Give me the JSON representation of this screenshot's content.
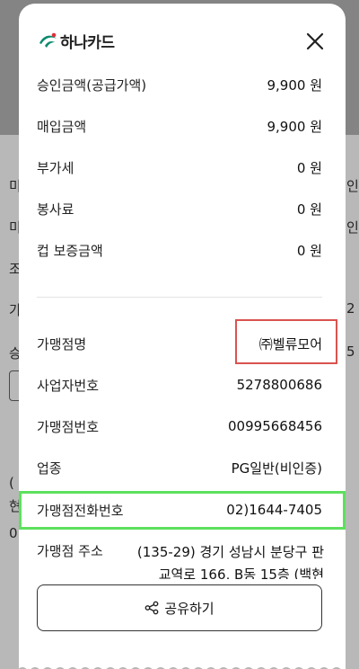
{
  "background": {
    "fragments_left": [
      "미",
      "미",
      "조",
      "가",
      "승",
      "(",
      "현",
      "0"
    ],
    "fragments_right": [
      "인",
      "인",
      "2",
      "5"
    ]
  },
  "receipt": {
    "brand": "하나카드",
    "rows_top": [
      {
        "label": "승인금액(공급가액)",
        "value": "9,900 원"
      },
      {
        "label": "매입금액",
        "value": "9,900 원"
      },
      {
        "label": "부가세",
        "value": "0 원"
      },
      {
        "label": "봉사료",
        "value": "0 원"
      },
      {
        "label": "컵 보증금액",
        "value": "0 원"
      }
    ],
    "rows_merchant": [
      {
        "label": "가맹점명",
        "value": "㈜벨류모어"
      },
      {
        "label": "사업자번호",
        "value": "5278800686"
      },
      {
        "label": "가맹점번호",
        "value": "00995668456"
      },
      {
        "label": "업종",
        "value": "PG일반(비인증)"
      },
      {
        "label": "가맹점전화번호",
        "value": "02)1644-7405"
      }
    ],
    "address": {
      "label": "가맹점 주소",
      "value": "(135-29) 경기 성남시 분당구 판교역로 166, B동 15층 (백현"
    },
    "share_label": "공유하기"
  },
  "colors": {
    "highlight_red": "#d9534f",
    "highlight_green": "#5ee05e",
    "logo_green": "#0b8a6f",
    "logo_red": "#e0303a"
  },
  "icons": {
    "close": "close-icon",
    "share": "share-icon",
    "logo": "hana-logo-icon"
  }
}
